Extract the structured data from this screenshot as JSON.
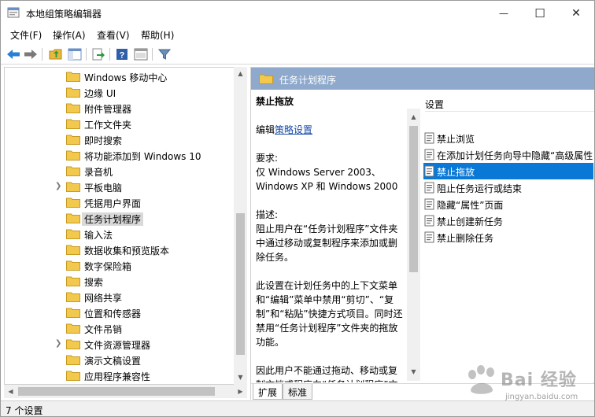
{
  "window": {
    "title": "本地组策略编辑器",
    "controls": {
      "minimize": "—",
      "maximize": "☐",
      "close": "✕"
    }
  },
  "menubar": [
    "文件(F)",
    "操作(A)",
    "查看(V)",
    "帮助(H)"
  ],
  "toolbar": [
    "back-icon",
    "forward-icon",
    "up-folder-icon",
    "show-hide-tree-icon",
    "export-list-icon",
    "help-icon",
    "properties-icon",
    "filter-icon"
  ],
  "tree": {
    "items": [
      {
        "label": "Windows 移动中心",
        "expandable": false,
        "selected": false
      },
      {
        "label": "边缘 UI",
        "expandable": false,
        "selected": false
      },
      {
        "label": "附件管理器",
        "expandable": false,
        "selected": false
      },
      {
        "label": "工作文件夹",
        "expandable": false,
        "selected": false
      },
      {
        "label": "即时搜索",
        "expandable": false,
        "selected": false
      },
      {
        "label": "将功能添加到 Windows 10",
        "expandable": false,
        "selected": false
      },
      {
        "label": "录音机",
        "expandable": false,
        "selected": false
      },
      {
        "label": "平板电脑",
        "expandable": true,
        "selected": false
      },
      {
        "label": "凭据用户界面",
        "expandable": false,
        "selected": false
      },
      {
        "label": "任务计划程序",
        "expandable": false,
        "selected": true
      },
      {
        "label": "输入法",
        "expandable": false,
        "selected": false
      },
      {
        "label": "数据收集和预览版本",
        "expandable": false,
        "selected": false
      },
      {
        "label": "数字保险箱",
        "expandable": false,
        "selected": false
      },
      {
        "label": "搜索",
        "expandable": false,
        "selected": false
      },
      {
        "label": "网络共享",
        "expandable": false,
        "selected": false
      },
      {
        "label": "位置和传感器",
        "expandable": false,
        "selected": false
      },
      {
        "label": "文件吊销",
        "expandable": false,
        "selected": false
      },
      {
        "label": "文件资源管理器",
        "expandable": true,
        "selected": false
      },
      {
        "label": "演示文稿设置",
        "expandable": false,
        "selected": false
      },
      {
        "label": "应用程序兼容性",
        "expandable": false,
        "selected": false
      }
    ]
  },
  "right_pane": {
    "header_title": "任务计划程序",
    "description": {
      "heading": "禁止拖放",
      "edit_prefix": "编辑",
      "edit_link": "策略设置",
      "requirements_label": "要求:",
      "requirements_line1": "仅 Windows Server 2003、",
      "requirements_line2": "Windows XP 和 Windows 2000",
      "desc_label": "描述:",
      "desc_text": "阻止用户在“任务计划程序”文件夹中通过移动或复制程序来添加或删除任务。",
      "desc_text2": "此设置在计划任务中的上下文菜单和“编辑”菜单中禁用“剪切”、“复制”和“粘贴”快捷方式项目。同时还禁用“任务计划程序”文件夹的拖放功能。",
      "desc_text3": "因此用户不能通过拖动、移动或复制文档或程序向“任务计划程序”文件夹添加新的计划任务。"
    },
    "settings_column_header": "设置",
    "settings": [
      {
        "label": "禁止浏览",
        "selected": false
      },
      {
        "label": "在添加计划任务向导中隐藏“高级属性”",
        "selected": false
      },
      {
        "label": "禁止拖放",
        "selected": true
      },
      {
        "label": "阻止任务运行或结束",
        "selected": false
      },
      {
        "label": "隐藏“属性”页面",
        "selected": false
      },
      {
        "label": "禁止创建新任务",
        "selected": false
      },
      {
        "label": "禁止删除任务",
        "selected": false
      }
    ],
    "tabs": [
      "扩展",
      "标准"
    ]
  },
  "statusbar": {
    "text": "7 个设置"
  },
  "watermark": {
    "text": "Bai 经验",
    "sub": "jingyan.baidu.com"
  },
  "colors": {
    "header_blue": "#8fa9cc",
    "selection_blue": "#0a78d7",
    "tree_selection_gray": "#d9d9d9",
    "link_blue": "#1a4ba8",
    "folder_yellow": "#f2c94c"
  }
}
